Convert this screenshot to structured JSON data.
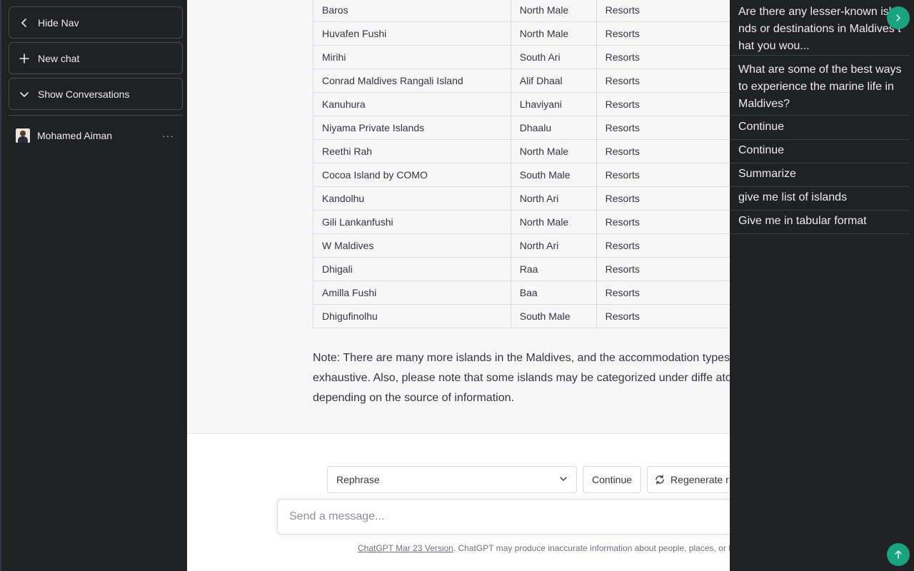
{
  "sidebar": {
    "hide_nav": "Hide Nav",
    "new_chat": "New chat",
    "show_conversations": "Show Conversations",
    "user_name": "Mohamed Aiman",
    "more": "···"
  },
  "table": {
    "rows": [
      [
        "Baros",
        "North Male",
        "Resorts"
      ],
      [
        "Huvafen Fushi",
        "North Male",
        "Resorts"
      ],
      [
        "Mirihi",
        "South Ari",
        "Resorts"
      ],
      [
        "Conrad Maldives Rangali Island",
        "Alif Dhaal",
        "Resorts"
      ],
      [
        "Kanuhura",
        "Lhaviyani",
        "Resorts"
      ],
      [
        "Niyama Private Islands",
        "Dhaalu",
        "Resorts"
      ],
      [
        "Reethi Rah",
        "North Male",
        "Resorts"
      ],
      [
        "Cocoa Island by COMO",
        "South Male",
        "Resorts"
      ],
      [
        "Kandolhu",
        "North Ari",
        "Resorts"
      ],
      [
        "Gili Lankanfushi",
        "North Male",
        "Resorts"
      ],
      [
        "W Maldives",
        "North Ari",
        "Resorts"
      ],
      [
        "Dhigali",
        "Raa",
        "Resorts"
      ],
      [
        "Amilla Fushi",
        "Baa",
        "Resorts"
      ],
      [
        "Dhigufinolhu",
        "South Male",
        "Resorts"
      ]
    ]
  },
  "note": "Note: There are many more islands in the Maldives, and the accommodation types l not exhaustive. Also, please note that some islands may be categorized under diffe atolls depending on the source of information.",
  "controls": {
    "rephrase": "Rephrase",
    "continue": "Continue",
    "regenerate": "Regenerate r"
  },
  "composer": {
    "placeholder": "Send a message..."
  },
  "footer": {
    "link": "ChatGPT Mar 23 Version",
    "text": ". ChatGPT may produce inaccurate information about people, places, or fa"
  },
  "right_panel": {
    "items": [
      "Are there any lesser-known isl nds or destinations in Maldives t hat you wou...",
      "What are some of the best ways to experience the marine life in Maldives?",
      "Continue",
      "Continue",
      "Summarize",
      "give me list of islands",
      "Give me in tabular format"
    ]
  },
  "colors": {
    "sidebar_bg": "#202123",
    "accent": "#19a37f"
  },
  "icons": {
    "hide_nav": "chevron-left-icon",
    "new_chat": "plus-icon",
    "show_conversations": "chevron-down-icon",
    "collapse": "chevron-right-icon",
    "scroll_top": "arrow-up-icon",
    "regenerate": "refresh-icon"
  }
}
